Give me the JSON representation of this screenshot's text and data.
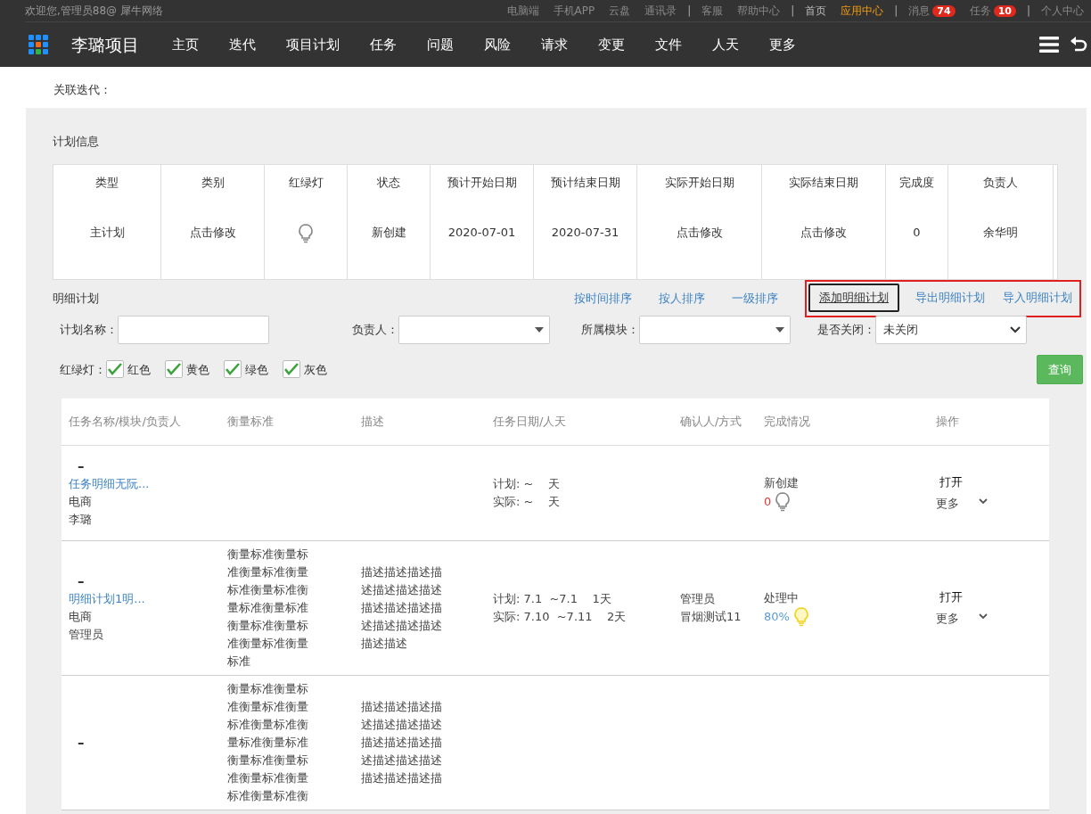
{
  "topbar": {
    "welcome": "欢迎您,管理员88@ 犀牛网络",
    "links": [
      {
        "kind": "link",
        "label": "电脑端",
        "active": false
      },
      {
        "kind": "link",
        "label": "手机APP",
        "active": false
      },
      {
        "kind": "link",
        "label": "云盘",
        "active": false
      },
      {
        "kind": "link",
        "label": "通讯录",
        "active": false
      },
      {
        "kind": "separator",
        "label": "|"
      },
      {
        "kind": "link",
        "label": "客服",
        "active": false
      },
      {
        "kind": "link",
        "label": "帮助中心",
        "active": false
      },
      {
        "kind": "separator",
        "label": "|"
      },
      {
        "kind": "link",
        "label": "首页",
        "active": false
      },
      {
        "kind": "link",
        "label": "应用中心",
        "active": true
      },
      {
        "kind": "separator",
        "label": "|"
      },
      {
        "kind": "link",
        "label": "消息",
        "active": false,
        "badge": "74"
      },
      {
        "kind": "link",
        "label": "任务",
        "active": false,
        "badge": "10"
      },
      {
        "kind": "separator",
        "label": "|"
      },
      {
        "kind": "link",
        "label": "个人中心",
        "active": false
      }
    ]
  },
  "navbar": {
    "project": "李璐项目",
    "items": [
      "主页",
      "迭代",
      "项目计划",
      "任务",
      "问题",
      "风险",
      "请求",
      "变更",
      "文件",
      "人天",
      "更多"
    ]
  },
  "related_iteration": "关联迭代：",
  "plan_info": {
    "title": "计划信息",
    "columns": [
      "类型",
      "类别",
      "红绿灯",
      "状态",
      "预计开始日期",
      "预计结束日期",
      "实际开始日期",
      "实际结束日期",
      "完成度",
      "负责人"
    ],
    "values": [
      {
        "kind": "text",
        "text": "主计划"
      },
      {
        "kind": "text",
        "text": "点击修改"
      },
      {
        "kind": "light",
        "lit": false
      },
      {
        "kind": "text",
        "text": "新创建"
      },
      {
        "kind": "text",
        "text": "2020-07-01"
      },
      {
        "kind": "text",
        "text": "2020-07-31"
      },
      {
        "kind": "text",
        "text": "点击修改"
      },
      {
        "kind": "text",
        "text": "点击修改"
      },
      {
        "kind": "text",
        "text": "0"
      },
      {
        "kind": "text",
        "text": "余华明"
      }
    ]
  },
  "detail": {
    "title": "明细计划",
    "sort_links": [
      "按时间排序",
      "按人排序",
      "一级排序"
    ],
    "action_links": [
      {
        "label": "添加明细计划",
        "focused": true
      },
      {
        "label": "导出明细计划",
        "focused": false
      },
      {
        "label": "导入明细计划",
        "focused": false
      }
    ],
    "filters": [
      {
        "kind": "input",
        "label": "计划名称："
      },
      {
        "kind": "select",
        "label": "负责人："
      },
      {
        "kind": "select",
        "label": "所属模块："
      },
      {
        "kind": "select",
        "label": "是否关闭：",
        "value": "未关闭"
      }
    ],
    "lights_label": "红绿灯：",
    "lights": [
      {
        "label": "红色",
        "checked": true
      },
      {
        "label": "黄色",
        "checked": true
      },
      {
        "label": "绿色",
        "checked": true
      },
      {
        "label": "灰色",
        "checked": true
      }
    ],
    "query_button": "查询"
  },
  "table": {
    "columns": [
      "任务名称/模块/负责人",
      "衡量标准",
      "描述",
      "任务日期/人天",
      "确认人/方式",
      "完成情况",
      "操作"
    ],
    "rows": [
      {
        "toggle": "–",
        "name": "任务明细无阮...",
        "module": "电商",
        "owner": "李璐",
        "measure": [],
        "description": [],
        "plan": "计划: ~    天",
        "actual": "实际: ~    天",
        "confirm": [],
        "status": "新创建",
        "progress": "0",
        "lit": false,
        "open": "打开",
        "more": "更多"
      },
      {
        "toggle": "–",
        "name": "明细计划1明...",
        "module": "电商",
        "owner": "管理员",
        "measure": [
          "衡量标准衡量标",
          "准衡量标准衡量",
          "标准衡量标准衡",
          "量标准衡量标准",
          "衡量标准衡量标",
          "准衡量标准衡量",
          "标准"
        ],
        "description": [
          "描述描述描述描",
          "述描述描述描述",
          "描述描述描述描",
          "述描述描述描述",
          "描述描述"
        ],
        "plan": "计划: 7.1  ~7.1    1天",
        "actual": "实际: 7.10  ~7.11    2天",
        "confirm": [
          "管理员",
          "冒烟测试11"
        ],
        "status": "处理中",
        "progress": "80%",
        "lit": true,
        "open": "打开",
        "more": "更多"
      },
      {
        "toggle": "–",
        "measure": [
          "衡量标准衡量标",
          "准衡量标准衡量",
          "标准衡量标准衡",
          "量标准衡量标准",
          "衡量标准衡量标",
          "准衡量标准衡量",
          "标准衡量标准衡"
        ],
        "description": [
          "描述描述描述描",
          "述描述描述描述",
          "描述描述描述描",
          "述描述描述描述",
          "描述描述描述描"
        ],
        "confirm": []
      }
    ]
  }
}
